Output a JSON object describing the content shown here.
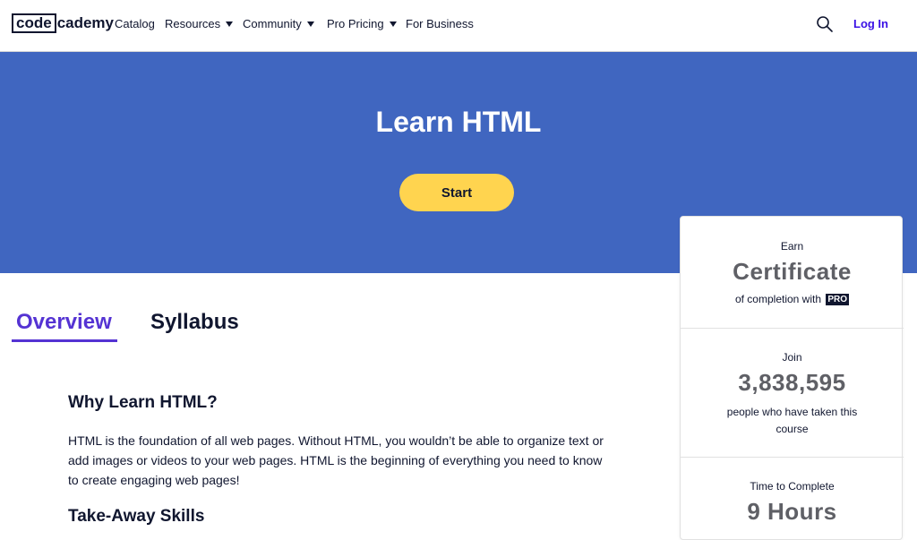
{
  "nav": {
    "logo_left": "code",
    "logo_right": "cademy",
    "catalog": "Catalog",
    "resources": "Resources",
    "community": "Community",
    "pro_pricing": "Pro Pricing",
    "for_business": "For Business",
    "login": "Log In",
    "search_icon": "search-icon"
  },
  "hero": {
    "title": "Learn HTML",
    "start": "Start"
  },
  "tabs": {
    "overview": "Overview",
    "syllabus": "Syllabus"
  },
  "content": {
    "why_title": "Why Learn HTML?",
    "why_body": "HTML is the foundation of all web pages. Without HTML, you wouldn’t be able to organize text or add images or videos to your web pages. HTML is the beginning of everything you need to know to create engaging web pages!",
    "skills_title": "Take-Away Skills"
  },
  "stats": {
    "earn_label": "Earn",
    "certificate": "Certificate",
    "completion_text": "of completion with",
    "pro_badge": "PRO",
    "join_label": "Join",
    "learner_count": "3,838,595",
    "people_text": "people who have taken this course",
    "time_label": "Time to Complete",
    "time_value": "9 Hours"
  },
  "colors": {
    "hero_bg": "#4066c0",
    "start_btn": "#ffd44f",
    "accent": "#5533d3",
    "login": "#3a10e5",
    "navy": "#10162f"
  }
}
